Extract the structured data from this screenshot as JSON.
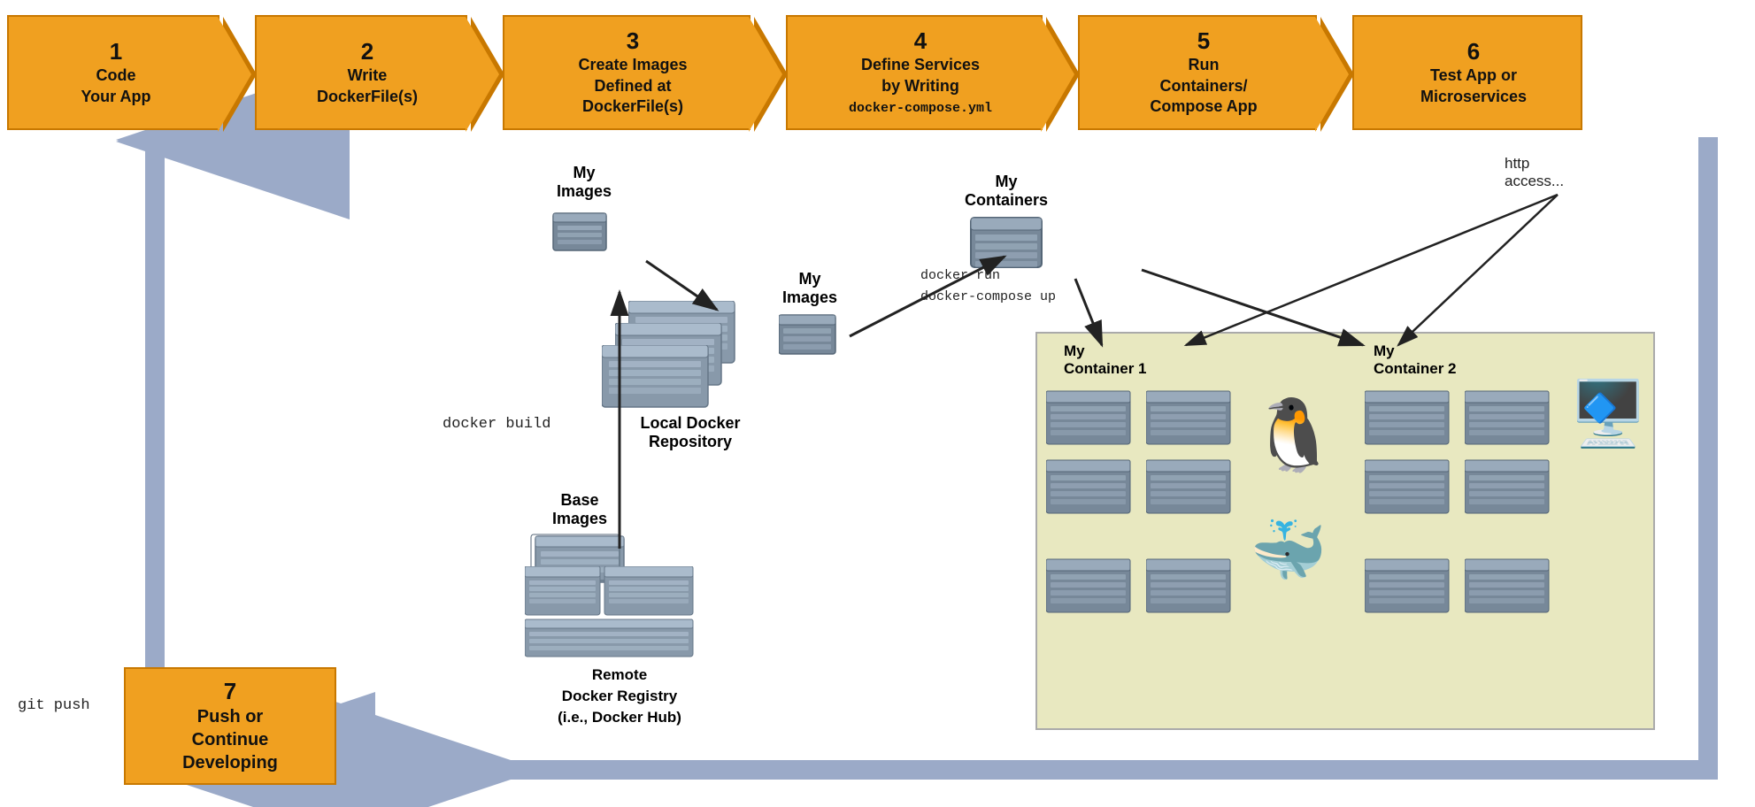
{
  "steps": [
    {
      "id": 1,
      "number": "1",
      "label": "Code\nYour App"
    },
    {
      "id": 2,
      "number": "2",
      "label": "Write\nDockerFile(s)"
    },
    {
      "id": 3,
      "number": "3",
      "label": "Create Images\nDefined at\nDockerFile(s)"
    },
    {
      "id": 4,
      "number": "4",
      "label": "Define Services\nby Writing\ndocker-compose.yml"
    },
    {
      "id": 5,
      "number": "5",
      "label": "Run\nContainers/\nCompose App"
    },
    {
      "id": 6,
      "number": "6",
      "label": "Test App or\nMicroservices"
    }
  ],
  "step7": {
    "number": "7",
    "label": "Push or\nContinue\nDeveloping"
  },
  "labels": {
    "docker_build": "docker build",
    "my_images_top": "My\nImages",
    "my_images_repo": "My\nImages",
    "base_images": "Base\nImages",
    "local_docker_repo": "Local Docker\nRepository",
    "remote_docker_registry": "Remote\nDocker Registry\n(i.e., Docker Hub)",
    "my_containers": "My\nContainers",
    "docker_run": "docker run\ndocker-compose up",
    "my_container1": "My\nContainer 1",
    "my_container2": "My\nContainer 2",
    "http_access": "http\naccess...",
    "git_push": "git push"
  },
  "colors": {
    "step_bg": "#f0a020",
    "step_border": "#c87800",
    "arrow_bg": "#9baac8",
    "container_area_bg": "#e8e8c8",
    "server_color": "#778899"
  }
}
